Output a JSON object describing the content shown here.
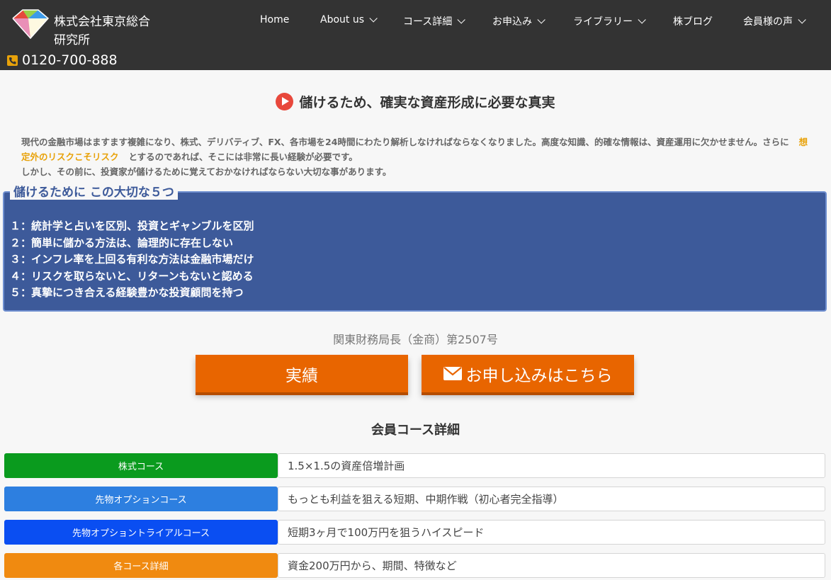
{
  "header": {
    "company_name": "株式会社東京総合研究所",
    "phone": "0120-700-888",
    "nav": [
      {
        "label": "Home",
        "dropdown": false
      },
      {
        "label": "About us",
        "dropdown": true
      },
      {
        "label": "コース詳細",
        "dropdown": true
      },
      {
        "label": "お申込み",
        "dropdown": true
      },
      {
        "label": "ライブラリー",
        "dropdown": true
      },
      {
        "label": "株ブログ",
        "dropdown": false
      },
      {
        "label": "会員様の声",
        "dropdown": true
      }
    ]
  },
  "main": {
    "heading": "儲けるため、確実な資産形成に必要な真実",
    "intro_1": "現代の金融市場はますます複雑になり、株式、デリバティブ、FX、各市場を24時間にわたり解析しなければならなくなりました。高度な知識、的確な情報は、資産運用に欠かせません。さらに",
    "intro_highlight": "想定外のリスクこそリスク",
    "intro_2": "とするのであれば、そこには非常に長い経験が必要です。",
    "intro_3": "しかし、その前に、投資家が儲けるために覚えておかなければならない大切な事があります。"
  },
  "points": {
    "title": "儲けるために この大切な５つ",
    "items": [
      "１：統計学と占いを区別、投資とギャンブルを区別",
      "２：簡単に儲かる方法は、論理的に存在しない",
      "３：インフレ率を上回る有利な方法は金融市場だけ",
      "４：リスクを取らないと、リターンもないと認める",
      "５：真摯につき合える経験豊かな投資顧問を持つ"
    ]
  },
  "license": "関東財務局長（金商）第2507号",
  "cta": {
    "results_label": "実績",
    "apply_label": "お申し込みはこちら"
  },
  "courses": {
    "heading": "会員コース詳細",
    "rows": [
      {
        "label": "株式コース",
        "desc": "1.5×1.5の資産倍増計画",
        "color": "#0a9b1e"
      },
      {
        "label": "先物オプションコース",
        "desc": "もっとも利益を狙える短期、中期作戦（初心者完全指導）",
        "color": "#2d7fe0"
      },
      {
        "label": "先物オプショントライアルコース",
        "desc": "短期3ヶ月で100万円を狙うハイスピード",
        "color": "#0a4ef2"
      },
      {
        "label": "各コース詳細",
        "desc": "資金200万円から、期間、特徴など",
        "color": "#f08a10"
      }
    ]
  },
  "colors": {
    "header_bg": "#333333",
    "accent_orange": "#e86500",
    "points_bg": "#3d5a9a",
    "highlight": "#e8a20a"
  }
}
